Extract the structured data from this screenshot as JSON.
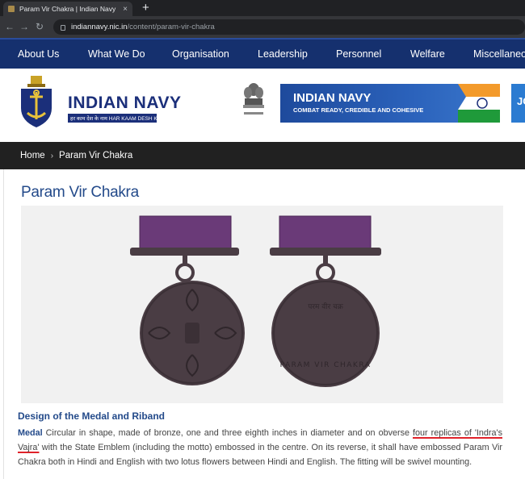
{
  "browser": {
    "tab_title": "Param Vir Chakra | Indian Navy",
    "tab_close": "×",
    "new_tab": "+",
    "url_host": "indiannavy.nic.in",
    "url_path": "/content/param-vir-chakra"
  },
  "nav": {
    "items": [
      "About Us",
      "What We Do",
      "Organisation",
      "Leadership",
      "Personnel",
      "Welfare",
      "Miscellaneous"
    ]
  },
  "header": {
    "brand_name": "INDIAN NAVY",
    "brand_motto": "हर काम देश के नाम  HAR KAAM DESH KE NAAM",
    "banner_title": "INDIAN NAVY",
    "banner_subtitle": "COMBAT READY, CREDIBLE AND COHESIVE",
    "banner2_text": "JO"
  },
  "breadcrumb": {
    "home": "Home",
    "sep": "›",
    "current": "Param Vir Chakra"
  },
  "page": {
    "title": "Param Vir Chakra",
    "medal_reverse_text": "PARAM VIR CHAKRA",
    "medal_hindi_text": "परम वीर चक्र",
    "section_heading": "Design of the Medal and Riband",
    "para_label": "Medal",
    "para_part1": " Circular in shape, made of bronze, one and three eighth inches in diameter and on obverse ",
    "para_underline": "four replicas of 'Indra's Vajra'",
    "para_part2": " with the State Emblem (including the motto) embossed in the centre. On its reverse, it shall have embossed Param Vir Chakra both in Hindi and English with two lotus flowers between Hindi and English. The fitting will be swivel mounting."
  },
  "colors": {
    "nav_bg": "#15306e",
    "title_blue": "#234a8a",
    "riband_purple": "#6a3a78",
    "medal_bronze": "#4a3d44"
  }
}
